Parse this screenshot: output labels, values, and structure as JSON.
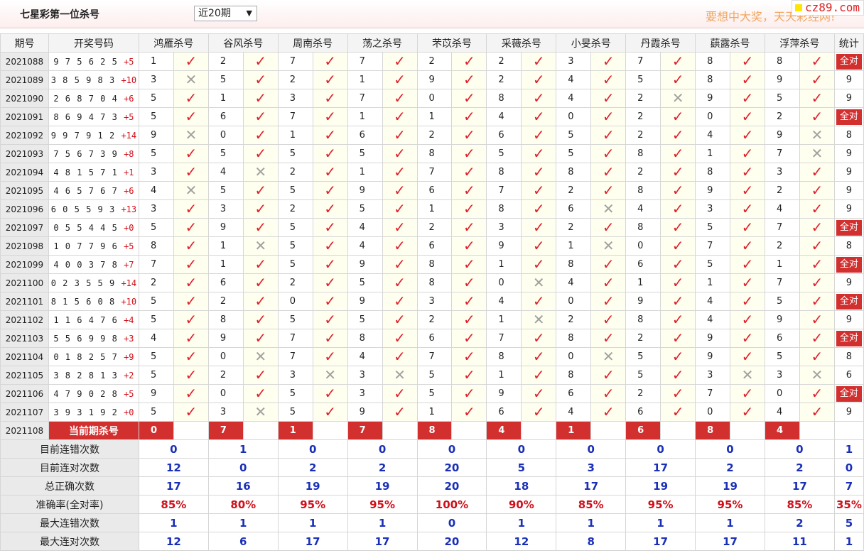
{
  "header": {
    "title": "七星彩第一位杀号",
    "period_select": "近20期",
    "slogan": "要想中大奖，天天彩经网!",
    "site_badge": "cz89.com"
  },
  "columns": [
    "期号",
    "开奖号码",
    "鸿雁杀号",
    "谷风杀号",
    "周南杀号",
    "荡之杀号",
    "芣苡杀号",
    "采薇杀号",
    "小旻杀号",
    "丹霞杀号",
    "蕻露杀号",
    "浮萍杀号",
    "统计"
  ],
  "rows": [
    {
      "period": "2021088",
      "digits": "9 7 5 6 2 5",
      "sum": "+5",
      "kills": [
        "1",
        "2",
        "7",
        "7",
        "2",
        "2",
        "3",
        "7",
        "8",
        "8"
      ],
      "marks": [
        "ok",
        "ok",
        "ok",
        "ok",
        "ok",
        "ok",
        "ok",
        "ok",
        "ok",
        "ok"
      ],
      "stat": "全对"
    },
    {
      "period": "2021089",
      "digits": "3 8 5 9 8 3",
      "sum": "+10",
      "kills": [
        "3",
        "5",
        "2",
        "1",
        "9",
        "2",
        "4",
        "5",
        "8",
        "9"
      ],
      "marks": [
        "bad",
        "ok",
        "ok",
        "ok",
        "ok",
        "ok",
        "ok",
        "ok",
        "ok",
        "ok"
      ],
      "stat": "9"
    },
    {
      "period": "2021090",
      "digits": "2 6 8 7 0 4",
      "sum": "+6",
      "kills": [
        "5",
        "1",
        "3",
        "7",
        "0",
        "8",
        "4",
        "2",
        "9",
        "5"
      ],
      "marks": [
        "ok",
        "ok",
        "ok",
        "ok",
        "ok",
        "ok",
        "ok",
        "bad",
        "ok",
        "ok"
      ],
      "stat": "9"
    },
    {
      "period": "2021091",
      "digits": "8 6 9 4 7 3",
      "sum": "+5",
      "kills": [
        "5",
        "6",
        "7",
        "1",
        "1",
        "4",
        "0",
        "2",
        "0",
        "2"
      ],
      "marks": [
        "ok",
        "ok",
        "ok",
        "ok",
        "ok",
        "ok",
        "ok",
        "ok",
        "ok",
        "ok"
      ],
      "stat": "全对"
    },
    {
      "period": "2021092",
      "digits": "9 9 7 9 1 2",
      "sum": "+14",
      "kills": [
        "9",
        "0",
        "1",
        "6",
        "2",
        "6",
        "5",
        "2",
        "4",
        "9"
      ],
      "marks": [
        "bad",
        "ok",
        "ok",
        "ok",
        "ok",
        "ok",
        "ok",
        "ok",
        "ok",
        "bad"
      ],
      "stat": "8"
    },
    {
      "period": "2021093",
      "digits": "7 5 6 7 3 9",
      "sum": "+8",
      "kills": [
        "5",
        "5",
        "5",
        "5",
        "8",
        "5",
        "5",
        "8",
        "1",
        "7"
      ],
      "marks": [
        "ok",
        "ok",
        "ok",
        "ok",
        "ok",
        "ok",
        "ok",
        "ok",
        "ok",
        "bad"
      ],
      "stat": "9"
    },
    {
      "period": "2021094",
      "digits": "4 8 1 5 7 1",
      "sum": "+1",
      "kills": [
        "3",
        "4",
        "2",
        "1",
        "7",
        "8",
        "8",
        "2",
        "8",
        "3"
      ],
      "marks": [
        "ok",
        "bad",
        "ok",
        "ok",
        "ok",
        "ok",
        "ok",
        "ok",
        "ok",
        "ok"
      ],
      "stat": "9"
    },
    {
      "period": "2021095",
      "digits": "4 6 5 7 6 7",
      "sum": "+6",
      "kills": [
        "4",
        "5",
        "5",
        "9",
        "6",
        "7",
        "2",
        "8",
        "9",
        "2"
      ],
      "marks": [
        "bad",
        "ok",
        "ok",
        "ok",
        "ok",
        "ok",
        "ok",
        "ok",
        "ok",
        "ok"
      ],
      "stat": "9"
    },
    {
      "period": "2021096",
      "digits": "6 0 5 5 9 3",
      "sum": "+13",
      "kills": [
        "3",
        "3",
        "2",
        "5",
        "1",
        "8",
        "6",
        "4",
        "3",
        "4"
      ],
      "marks": [
        "ok",
        "ok",
        "ok",
        "ok",
        "ok",
        "ok",
        "bad",
        "ok",
        "ok",
        "ok"
      ],
      "stat": "9"
    },
    {
      "period": "2021097",
      "digits": "0 5 5 4 4 5",
      "sum": "+0",
      "kills": [
        "5",
        "9",
        "5",
        "4",
        "2",
        "3",
        "2",
        "8",
        "5",
        "7"
      ],
      "marks": [
        "ok",
        "ok",
        "ok",
        "ok",
        "ok",
        "ok",
        "ok",
        "ok",
        "ok",
        "ok"
      ],
      "stat": "全对"
    },
    {
      "period": "2021098",
      "digits": "1 0 7 7 9 6",
      "sum": "+5",
      "kills": [
        "8",
        "1",
        "5",
        "4",
        "6",
        "9",
        "1",
        "0",
        "7",
        "2"
      ],
      "marks": [
        "ok",
        "bad",
        "ok",
        "ok",
        "ok",
        "ok",
        "bad",
        "ok",
        "ok",
        "ok"
      ],
      "stat": "8"
    },
    {
      "period": "2021099",
      "digits": "4 0 0 3 7 8",
      "sum": "+7",
      "kills": [
        "7",
        "1",
        "5",
        "9",
        "8",
        "1",
        "8",
        "6",
        "5",
        "1"
      ],
      "marks": [
        "ok",
        "ok",
        "ok",
        "ok",
        "ok",
        "ok",
        "ok",
        "ok",
        "ok",
        "ok"
      ],
      "stat": "全对"
    },
    {
      "period": "2021100",
      "digits": "0 2 3 5 5 9",
      "sum": "+14",
      "kills": [
        "2",
        "6",
        "2",
        "5",
        "8",
        "0",
        "4",
        "1",
        "1",
        "7"
      ],
      "marks": [
        "ok",
        "ok",
        "ok",
        "ok",
        "ok",
        "bad",
        "ok",
        "ok",
        "ok",
        "ok"
      ],
      "stat": "9"
    },
    {
      "period": "2021101",
      "digits": "8 1 5 6 0 8",
      "sum": "+10",
      "kills": [
        "5",
        "2",
        "0",
        "9",
        "3",
        "4",
        "0",
        "9",
        "4",
        "5"
      ],
      "marks": [
        "ok",
        "ok",
        "ok",
        "ok",
        "ok",
        "ok",
        "ok",
        "ok",
        "ok",
        "ok"
      ],
      "stat": "全对"
    },
    {
      "period": "2021102",
      "digits": "1 1 6 4 7 6",
      "sum": "+4",
      "kills": [
        "5",
        "8",
        "5",
        "5",
        "2",
        "1",
        "2",
        "8",
        "4",
        "9"
      ],
      "marks": [
        "ok",
        "ok",
        "ok",
        "ok",
        "ok",
        "bad",
        "ok",
        "ok",
        "ok",
        "ok"
      ],
      "stat": "9"
    },
    {
      "period": "2021103",
      "digits": "5 5 6 9 9 8",
      "sum": "+3",
      "kills": [
        "4",
        "9",
        "7",
        "8",
        "6",
        "7",
        "8",
        "2",
        "9",
        "6"
      ],
      "marks": [
        "ok",
        "ok",
        "ok",
        "ok",
        "ok",
        "ok",
        "ok",
        "ok",
        "ok",
        "ok"
      ],
      "stat": "全对"
    },
    {
      "period": "2021104",
      "digits": "0 1 8 2 5 7",
      "sum": "+9",
      "kills": [
        "5",
        "0",
        "7",
        "4",
        "7",
        "8",
        "0",
        "5",
        "9",
        "5"
      ],
      "marks": [
        "ok",
        "bad",
        "ok",
        "ok",
        "ok",
        "ok",
        "bad",
        "ok",
        "ok",
        "ok"
      ],
      "stat": "8"
    },
    {
      "period": "2021105",
      "digits": "3 8 2 8 1 3",
      "sum": "+2",
      "kills": [
        "5",
        "2",
        "3",
        "3",
        "5",
        "1",
        "8",
        "5",
        "3",
        "3"
      ],
      "marks": [
        "ok",
        "ok",
        "bad",
        "bad",
        "ok",
        "ok",
        "ok",
        "ok",
        "bad",
        "bad"
      ],
      "stat": "6"
    },
    {
      "period": "2021106",
      "digits": "4 7 9 0 2 8",
      "sum": "+5",
      "kills": [
        "9",
        "0",
        "5",
        "3",
        "5",
        "9",
        "6",
        "2",
        "7",
        "0"
      ],
      "marks": [
        "ok",
        "ok",
        "ok",
        "ok",
        "ok",
        "ok",
        "ok",
        "ok",
        "ok",
        "ok"
      ],
      "stat": "全对"
    },
    {
      "period": "2021107",
      "digits": "3 9 3 1 9 2",
      "sum": "+0",
      "kills": [
        "5",
        "3",
        "5",
        "9",
        "1",
        "6",
        "4",
        "6",
        "0",
        "4"
      ],
      "marks": [
        "ok",
        "bad",
        "ok",
        "ok",
        "ok",
        "ok",
        "ok",
        "ok",
        "ok",
        "ok"
      ],
      "stat": "9"
    }
  ],
  "current": {
    "period": "2021108",
    "label": "当前期杀号",
    "kills": [
      "0",
      "7",
      "1",
      "7",
      "8",
      "4",
      "1",
      "6",
      "8",
      "4"
    ]
  },
  "stats": [
    {
      "label": "目前连错次数",
      "values": [
        "0",
        "1",
        "0",
        "0",
        "0",
        "0",
        "0",
        "0",
        "0",
        "0",
        "1"
      ],
      "red": false
    },
    {
      "label": "目前连对次数",
      "values": [
        "12",
        "0",
        "2",
        "2",
        "20",
        "5",
        "3",
        "17",
        "2",
        "2",
        "0"
      ],
      "red": false
    },
    {
      "label": "总正确次数",
      "values": [
        "17",
        "16",
        "19",
        "19",
        "20",
        "18",
        "17",
        "19",
        "19",
        "17",
        "7"
      ],
      "red": false
    },
    {
      "label": "准确率(全对率)",
      "values": [
        "85%",
        "80%",
        "95%",
        "95%",
        "100%",
        "90%",
        "85%",
        "95%",
        "95%",
        "85%",
        "35%"
      ],
      "red": true
    },
    {
      "label": "最大连错次数",
      "values": [
        "1",
        "1",
        "1",
        "1",
        "0",
        "1",
        "1",
        "1",
        "1",
        "2",
        "5"
      ],
      "red": false
    },
    {
      "label": "最大连对次数",
      "values": [
        "12",
        "6",
        "17",
        "17",
        "20",
        "12",
        "8",
        "17",
        "17",
        "11",
        "1"
      ],
      "red": false
    }
  ],
  "colors": {
    "accent_red": "#d22f2f",
    "check_red": "#e0202a",
    "stat_blue": "#1a2fb8",
    "slogan_orange": "#f0a55e"
  }
}
